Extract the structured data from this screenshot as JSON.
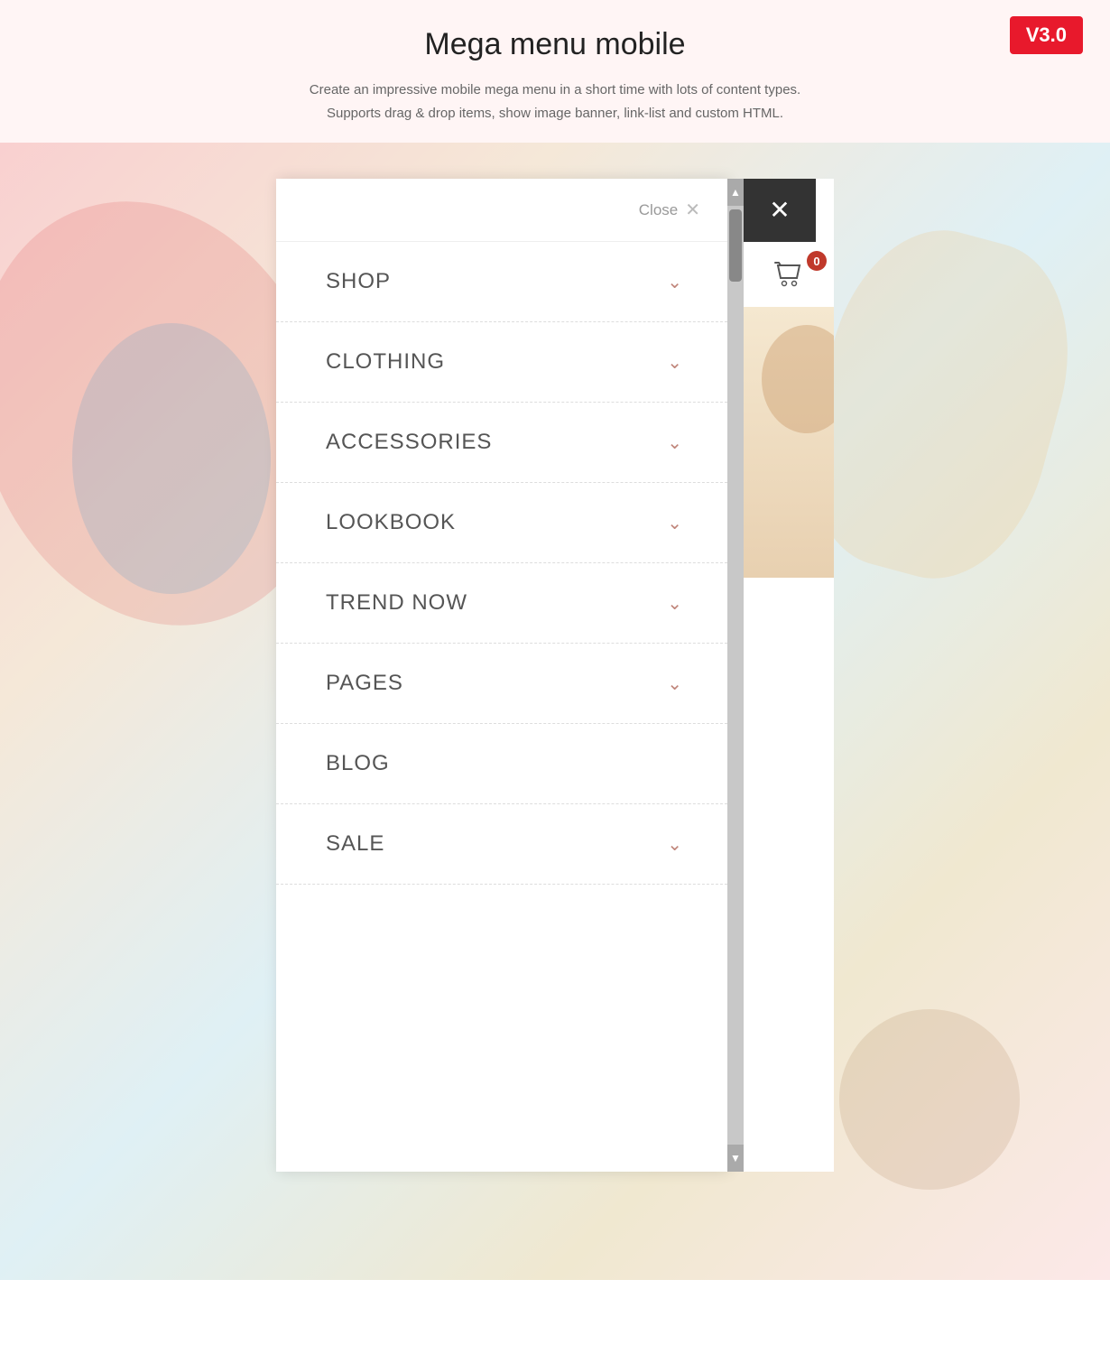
{
  "header": {
    "title": "Mega menu mobile",
    "description_line1": "Create an impressive mobile mega menu in a short time with lots of content types.",
    "description_line2": "Supports drag & drop items, show image banner, link-list and custom HTML.",
    "version": "V3.0"
  },
  "menu": {
    "close_label": "Close",
    "items": [
      {
        "id": "shop",
        "label": "SHOP",
        "has_chevron": true
      },
      {
        "id": "clothing",
        "label": "CLOTHING",
        "has_chevron": true
      },
      {
        "id": "accessories",
        "label": "ACCESSORIES",
        "has_chevron": true
      },
      {
        "id": "lookbook",
        "label": "LOOKBOOK",
        "has_chevron": true
      },
      {
        "id": "trend-now",
        "label": "TREND NOW",
        "has_chevron": true
      },
      {
        "id": "pages",
        "label": "PAGES",
        "has_chevron": true
      },
      {
        "id": "blog",
        "label": "BLOG",
        "has_chevron": false
      },
      {
        "id": "sale",
        "label": "SALE",
        "has_chevron": true
      }
    ],
    "cart_count": "0"
  },
  "colors": {
    "accent_red": "#e8192c",
    "chevron_color": "#c0857a",
    "menu_text": "#555555"
  }
}
